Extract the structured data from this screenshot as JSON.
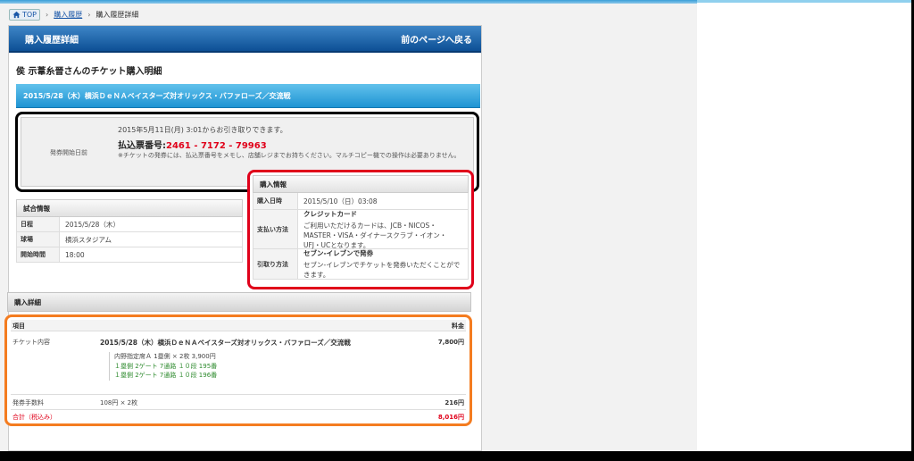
{
  "breadcrumb": {
    "top": "TOP",
    "history": "購入履歴",
    "current": "購入履歴詳細"
  },
  "header": {
    "title": "購入履歴詳細",
    "back": "前のページへ戻る"
  },
  "ticket_heading": "侯 示葦糸晉さんのチケット購入明細",
  "event_title": "2015/5/28（木）横浜ＤｅＮＡベイスターズ対オリックス・バファローズ／交流戦",
  "issue": {
    "label": "発券開始日前",
    "line1": "2015年5月11日(月) 3:01からお引き取りできます。",
    "code_label": "払込票番号:",
    "code": "2461 - 7172 - 79963",
    "note": "※チケットの発券には、払込票番号をメモし、店舗レジまでお持ちください。マルチコピー機での操作は必要ありません。"
  },
  "match_info": {
    "heading": "試合情報",
    "rows": [
      {
        "label": "日程",
        "value": "2015/5/28（木）"
      },
      {
        "label": "球場",
        "value": "横浜スタジアム"
      },
      {
        "label": "開始時間",
        "value": "18:00"
      }
    ]
  },
  "purchase_info": {
    "heading": "購入情報",
    "rows": [
      {
        "label": "購入日時",
        "title": "",
        "value": "2015/5/10（日）03:08"
      },
      {
        "label": "支払い方法",
        "title": "クレジットカード",
        "value": "ご利用いただけるカードは、JCB・NICOS・MASTER・VISA・ダイナースクラブ・イオン・UFJ・UCとなります。"
      },
      {
        "label": "引取り方法",
        "title": "セブン-イレブンで発券",
        "value": "セブン-イレブンでチケットを発券いただくことができます。"
      }
    ]
  },
  "details": {
    "heading": "購入詳細",
    "col_item": "項目",
    "col_price": "料金",
    "ticket_label": "チケット内容",
    "ticket_event": "2015/5/28（木）横浜ＤｅＮＡベイスターズ対オリックス・バファローズ／交流戦",
    "ticket_price": "7,800円",
    "seat_summary": "内野指定席Ａ 1塁側 × 2枚 3,900円",
    "seats": [
      "１塁側 2ゲート 7通路 １０段 195番",
      "１塁側 2ゲート 7通路 １０段 196番"
    ],
    "fee_label": "発券手数料",
    "fee_detail": "108円 × 2枚",
    "fee_price": "216円",
    "total_label": "合計（税込み）",
    "total_price": "8,016円"
  }
}
